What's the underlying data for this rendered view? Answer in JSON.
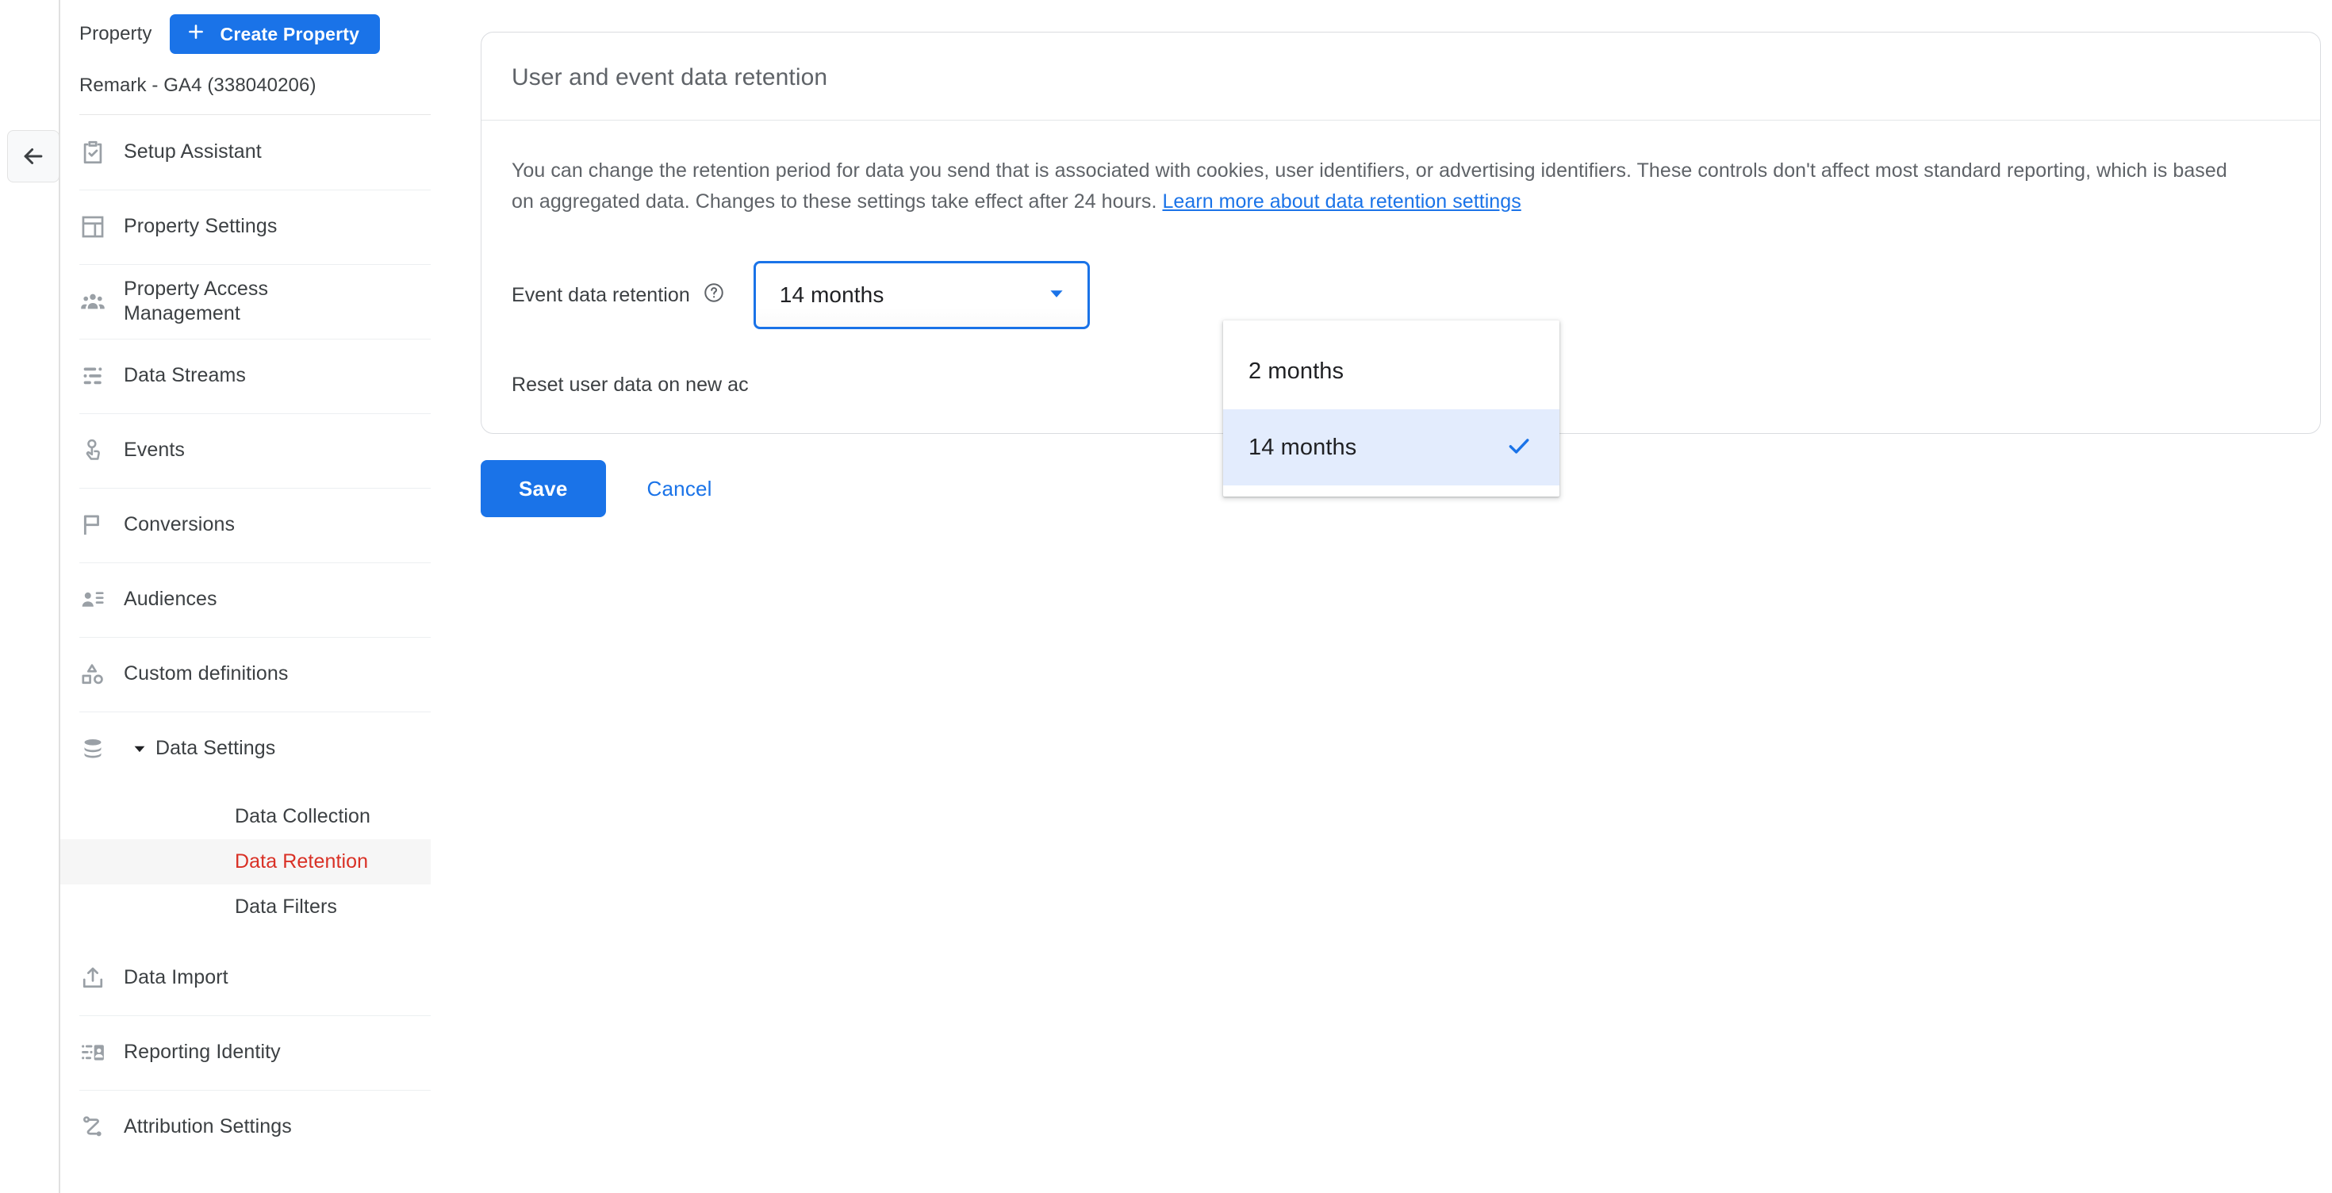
{
  "rail": {
    "back_icon": "arrow-left-icon"
  },
  "sidebar": {
    "property_label": "Property",
    "create_button": "Create Property",
    "plus_icon": "plus-icon",
    "property_name": "Remark - GA4 (338040206)",
    "items": [
      {
        "label": "Setup Assistant",
        "icon": "clipboard-check-icon"
      },
      {
        "label": "Property Settings",
        "icon": "layout-panel-icon"
      },
      {
        "label": "Property Access Management",
        "icon": "people-group-icon"
      },
      {
        "label": "Data Streams",
        "icon": "data-streams-icon"
      },
      {
        "label": "Events",
        "icon": "touch-pointer-icon"
      },
      {
        "label": "Conversions",
        "icon": "flag-icon"
      },
      {
        "label": "Audiences",
        "icon": "person-list-icon"
      },
      {
        "label": "Custom definitions",
        "icon": "shapes-icon"
      },
      {
        "label": "Data Settings",
        "icon": "database-icon",
        "expander_icon": "caret-down-icon"
      },
      {
        "label": "Data Import",
        "icon": "upload-icon"
      },
      {
        "label": "Reporting Identity",
        "icon": "reporting-identity-icon"
      },
      {
        "label": "Attribution Settings",
        "icon": "attribution-icon"
      }
    ],
    "data_settings_children": [
      {
        "label": "Data Collection",
        "active": false
      },
      {
        "label": "Data Retention",
        "active": true
      },
      {
        "label": "Data Filters",
        "active": false
      }
    ],
    "active_color": "#d93025",
    "scrollbar": "sidebar-scrollbar"
  },
  "card": {
    "title": "User and event data retention",
    "description_part1": "You can change the retention period for data you send that is associated with cookies, user identifiers, or advertising identifiers. These controls don't affect most standard reporting, which is based on aggregated data. Changes to these settings take effect after 24 hours. ",
    "learn_more_link": "Learn more about data retention settings",
    "event_retention_label": "Event data retention",
    "help_icon": "help-circle-icon",
    "event_retention_value": "14 months",
    "dropdown_arrow_icon": "chevron-down-icon",
    "reset_label": "Reset user data on new ac",
    "save_label": "Save",
    "cancel_label": "Cancel"
  },
  "dropdown": {
    "open": true,
    "options": [
      {
        "label": "2 months",
        "selected": false
      },
      {
        "label": "14 months",
        "selected": true
      }
    ],
    "check_icon": "check-icon",
    "selected_bg": "#e3ecfd",
    "accent": "#1a73e8"
  },
  "colors": {
    "primary": "#1a73e8",
    "link": "#1a73e8",
    "active_nav": "#d93025",
    "text": "#3c4043",
    "muted": "#5f6368"
  }
}
